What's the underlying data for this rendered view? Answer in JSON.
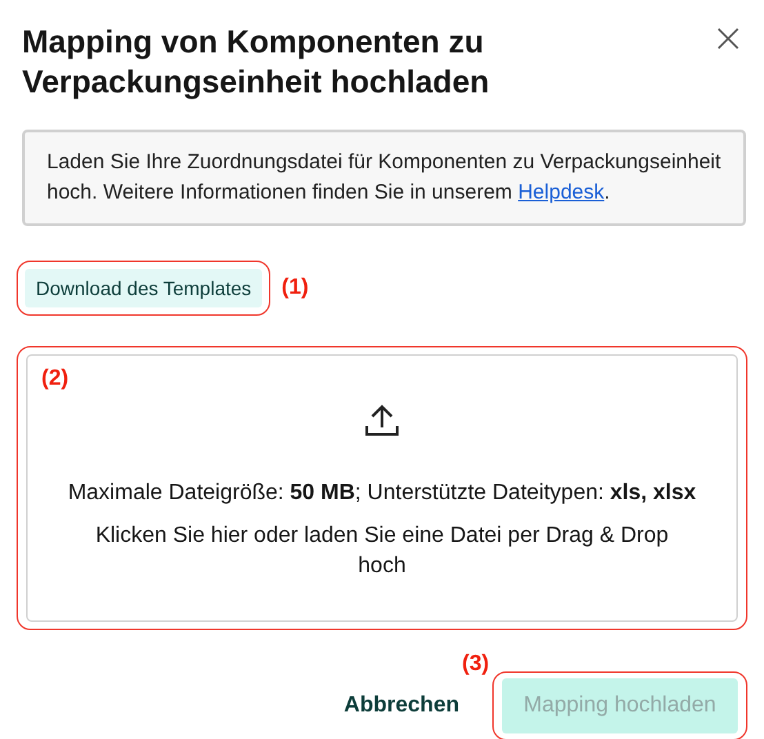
{
  "dialog": {
    "title": "Mapping von Komponenten zu Verpackungseinheit hochladen",
    "info": {
      "text": "Laden Sie Ihre Zuordnungsdatei für Komponenten zu Verpackungseinheit hoch. Weitere Informationen finden Sie in unserem ",
      "link": "Helpdesk",
      "suffix": "."
    },
    "download_button": {
      "label": "Download des Templates",
      "annotation": "(1)"
    },
    "dropzone": {
      "annotation": "(2)",
      "limits": "Maximale Dateigröße: **50 MB**; Unterstützte Dateitypen: **xls, xlsx**",
      "hint": "Klicken Sie hier oder laden Sie eine Datei per Drag & Drop hoch"
    },
    "footer": {
      "cancel": "Abbrechen",
      "submit": {
        "label": "Mapping hochladen",
        "disabled": true,
        "annotation": "(3)"
      }
    }
  }
}
